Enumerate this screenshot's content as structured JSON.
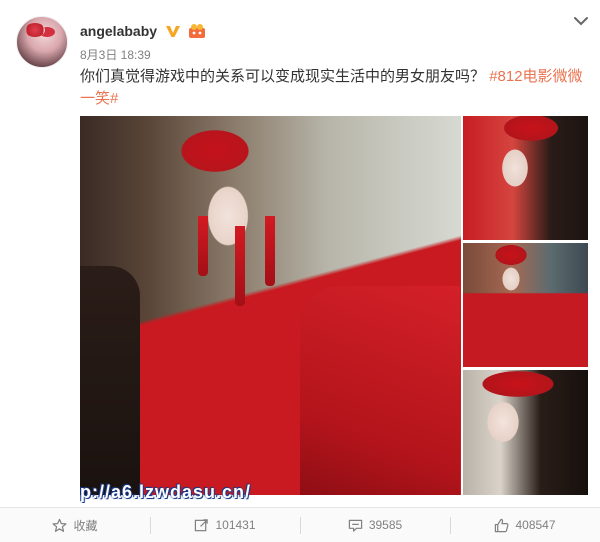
{
  "post": {
    "username": "angelababy",
    "date": "8月3日 18:39",
    "text_main": "你们真觉得游戏中的关系可以变成现实生活中的男女朋友吗？",
    "topic_tag": "#812电影微微一笑#",
    "watermark": "p://a6.lzwdasu.cn/"
  },
  "icons": {
    "verified": "verified-v-icon",
    "emoji": "emoji-badge-icon",
    "collapse": "chevron-down-icon",
    "favorite": "star-icon",
    "repost": "repost-icon",
    "comment": "comment-icon",
    "like": "thumbs-up-icon"
  },
  "actions": {
    "favorite_label": "收藏",
    "repost_count": "101431",
    "comment_count": "39585",
    "like_count": "408547"
  },
  "colors": {
    "topic": "#eb7350",
    "verified": "#f5a623",
    "meta": "#808080"
  }
}
